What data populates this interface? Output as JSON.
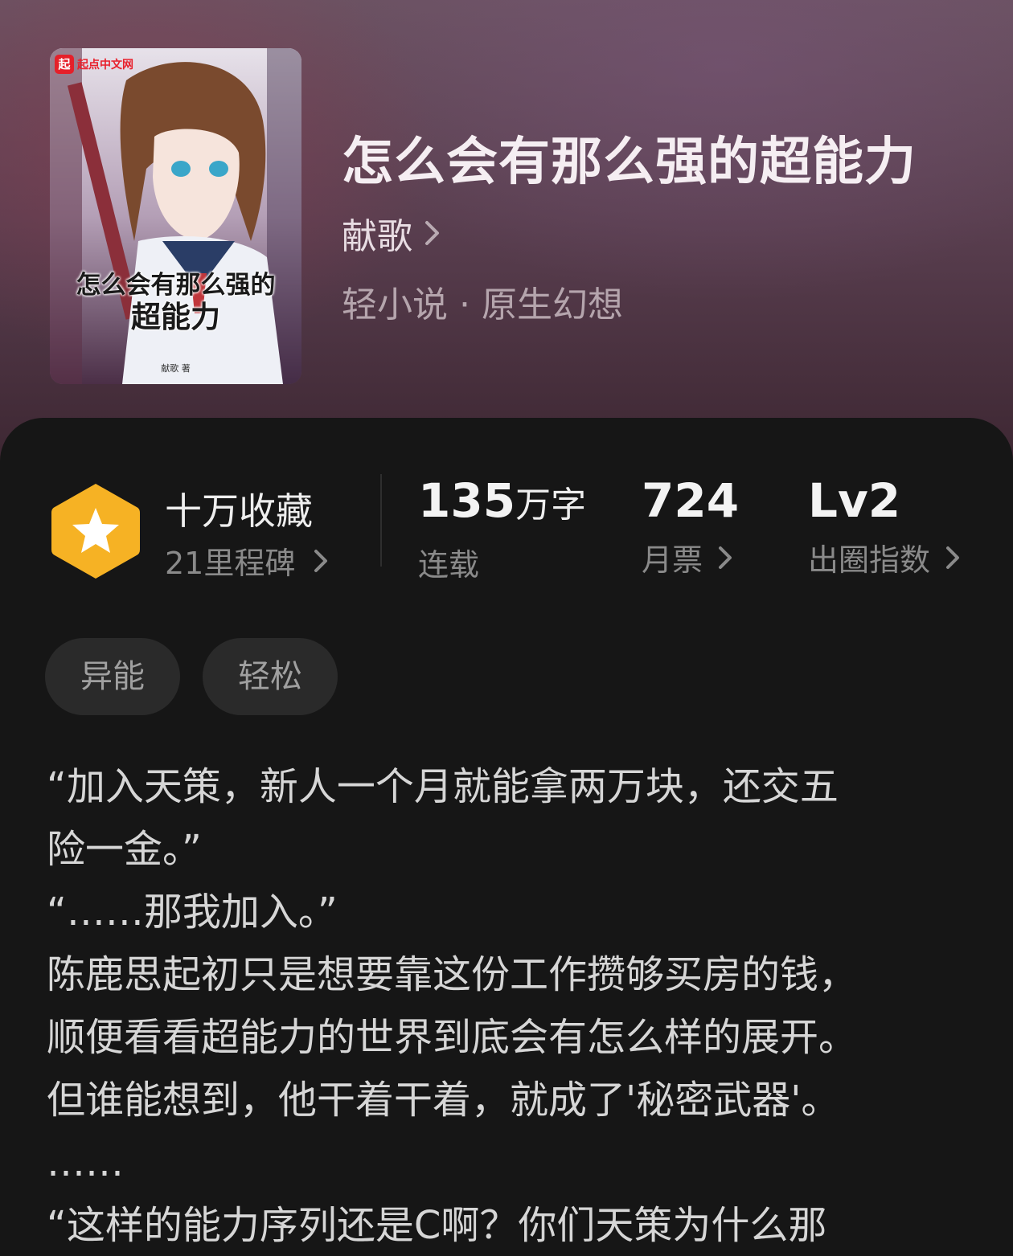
{
  "book": {
    "title": "怎么会有那么强的超能力",
    "author": "献歌",
    "category": "轻小说 · 原生幻想"
  },
  "cover": {
    "logo_mark": "起",
    "logo_text": "起点中文网",
    "title_line1": "怎么会有那么强的",
    "title_line2": "超能力",
    "author_line": "献歌 著"
  },
  "stats": {
    "collection_title": "十万收藏",
    "collection_sub": "21里程碑",
    "word_count": "135",
    "word_unit": "万字",
    "word_label": "连载",
    "monthly_votes": "724",
    "monthly_label": "月票",
    "level": "Lv2",
    "level_label": "出圈指数"
  },
  "tags": [
    "异能",
    "轻松"
  ],
  "synopsis": [
    "“加入天策，新人一个月就能拿两万块，还交五",
    "险一金。”",
    "“……那我加入。”",
    "陈鹿思起初只是想要靠这份工作攒够买房的钱，",
    "顺便看看超能力的世界到底会有怎么样的展开。",
    "但谁能想到，他干着干着，就成了'秘密武器'。",
    "……",
    "“这样的能力序列还是C啊？你们天策为什么那"
  ],
  "colors": {
    "badge": "#f6b224",
    "background": "#161616",
    "tag_bg": "#2a2a2a"
  },
  "icons": {
    "badge": "star-hexagon-icon",
    "chevron": "chevron-right-icon"
  }
}
